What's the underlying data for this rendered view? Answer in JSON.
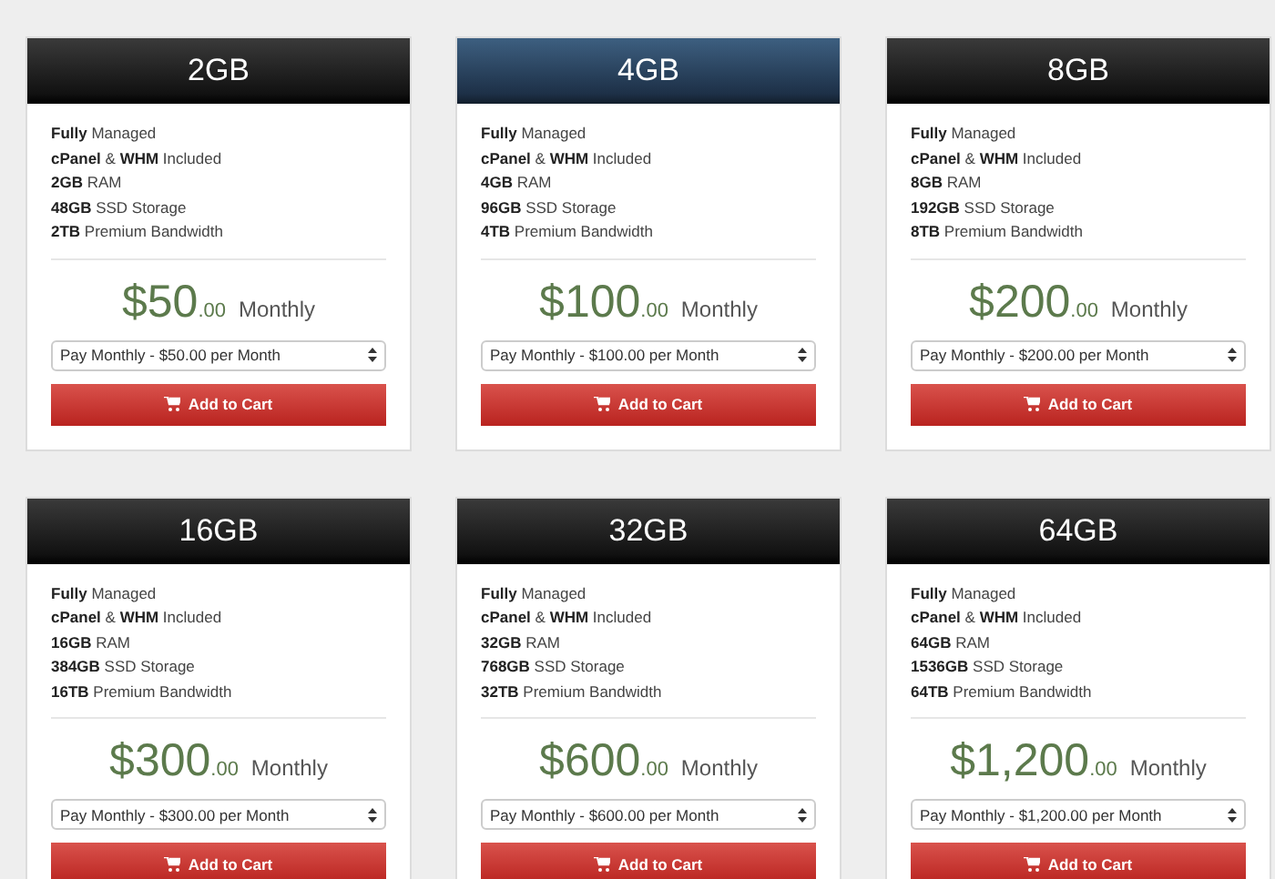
{
  "plans": [
    {
      "title": "2GB",
      "highlighted": false,
      "features": [
        "**Fully** Managed",
        "**cPanel** & **WHM** Included",
        "**2GB** RAM",
        "**48GB** SSD Storage",
        "**2TB** Premium Bandwidth"
      ],
      "amount": "$50",
      "cents": ".00",
      "period": "Monthly",
      "billing": "Pay Monthly - $50.00 per Month",
      "button": "Add to Cart"
    },
    {
      "title": "4GB",
      "highlighted": true,
      "features": [
        "**Fully** Managed",
        "**cPanel** & **WHM** Included",
        "**4GB** RAM",
        "**96GB** SSD Storage",
        "**4TB** Premium Bandwidth"
      ],
      "amount": "$100",
      "cents": ".00",
      "period": "Monthly",
      "billing": "Pay Monthly - $100.00 per Month",
      "button": "Add to Cart"
    },
    {
      "title": "8GB",
      "highlighted": false,
      "features": [
        "**Fully** Managed",
        "**cPanel** & **WHM** Included",
        "**8GB** RAM",
        "**192GB** SSD Storage",
        "**8TB** Premium Bandwidth"
      ],
      "amount": "$200",
      "cents": ".00",
      "period": "Monthly",
      "billing": "Pay Monthly - $200.00 per Month",
      "button": "Add to Cart"
    },
    {
      "title": "16GB",
      "highlighted": false,
      "features": [
        "**Fully** Managed",
        "**cPanel** & **WHM** Included",
        "**16GB** RAM",
        "**384GB** SSD Storage",
        "**16TB** Premium Bandwidth"
      ],
      "amount": "$300",
      "cents": ".00",
      "period": "Monthly",
      "billing": "Pay Monthly - $300.00 per Month",
      "button": "Add to Cart"
    },
    {
      "title": "32GB",
      "highlighted": false,
      "features": [
        "**Fully** Managed",
        "**cPanel** & **WHM** Included",
        "**32GB** RAM",
        "**768GB** SSD Storage",
        "**32TB** Premium Bandwidth"
      ],
      "amount": "$600",
      "cents": ".00",
      "period": "Monthly",
      "billing": "Pay Monthly - $600.00 per Month",
      "button": "Add to Cart"
    },
    {
      "title": "64GB",
      "highlighted": false,
      "features": [
        "**Fully** Managed",
        "**cPanel** & **WHM** Included",
        "**64GB** RAM",
        "**1536GB** SSD Storage",
        "**64TB** Premium Bandwidth"
      ],
      "amount": "$1,200",
      "cents": ".00",
      "period": "Monthly",
      "billing": "Pay Monthly - $1,200.00 per Month",
      "button": "Add to Cart"
    }
  ]
}
